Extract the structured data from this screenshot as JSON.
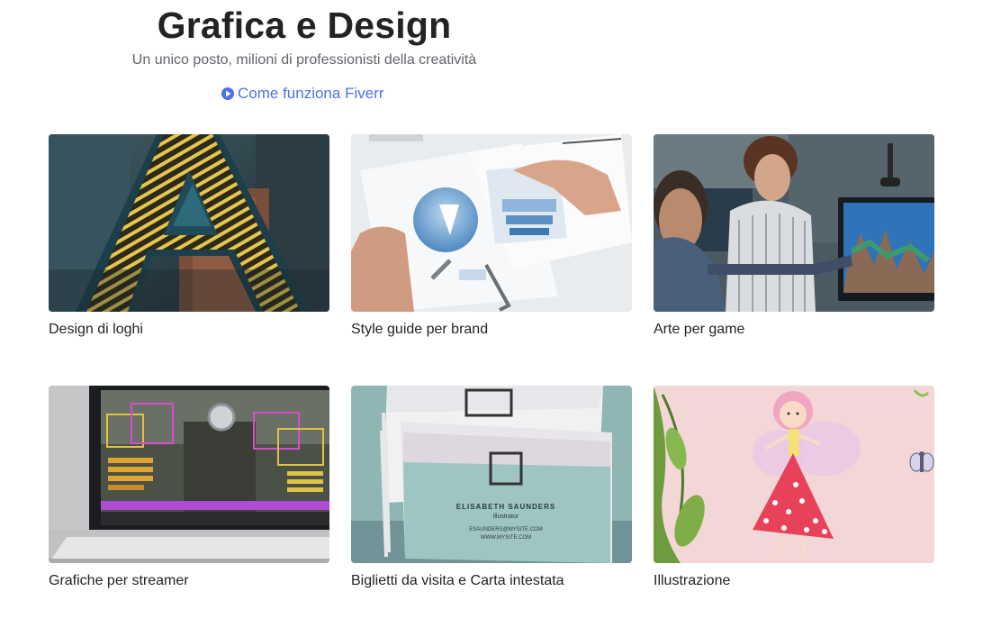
{
  "header": {
    "title": "Grafica e Design",
    "subtitle": "Un unico posto, milioni di professionisti della creatività",
    "how_link": "Come funziona Fiverr"
  },
  "colors": {
    "link": "#4a73e8",
    "title": "#222325",
    "subtitle": "#62646a"
  },
  "categories": [
    {
      "label": "Design di loghi",
      "image": "giant-letter-a-sign"
    },
    {
      "label": "Style guide per brand",
      "image": "brand-style-guide-sheets"
    },
    {
      "label": "Arte per game",
      "image": "game-artists-at-monitor"
    },
    {
      "label": "Grafiche per streamer",
      "image": "streaming-overlay-laptop"
    },
    {
      "label": "Biglietti da visita e Carta intestata",
      "image": "business-cards-stack"
    },
    {
      "label": "Illustrazione",
      "image": "fairy-illustration"
    }
  ],
  "business_card": {
    "name": "ELISABETH SAUNDERS",
    "role": "illustrator",
    "email": "ESAUNDERS@MYSITE.COM",
    "site": "WWW.MYSITE.COM"
  }
}
